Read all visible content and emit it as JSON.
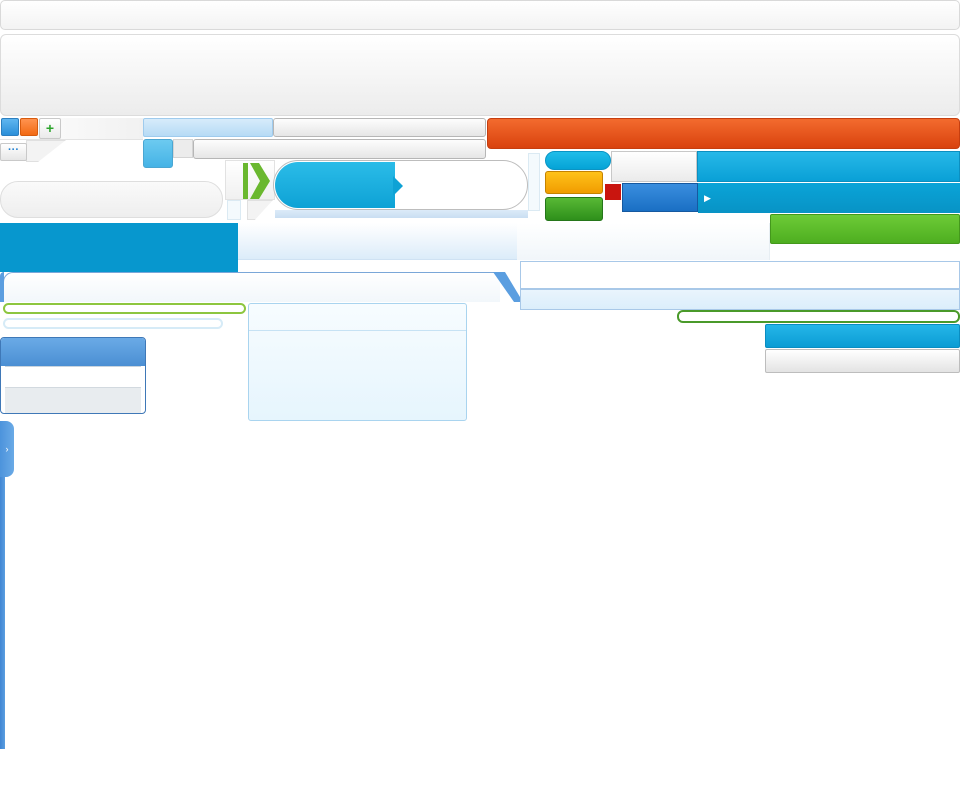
{
  "theme": {
    "accent_blue": "#0797ce",
    "accent_orange": "#e2521b",
    "accent_green": "#5bbd2c",
    "accent_yellow": "#f7ae0a",
    "accent_red": "#c9150f"
  },
  "icons": {
    "plus": "+",
    "dots": "···",
    "arrow_right": "▶",
    "chevron_right": "›"
  }
}
